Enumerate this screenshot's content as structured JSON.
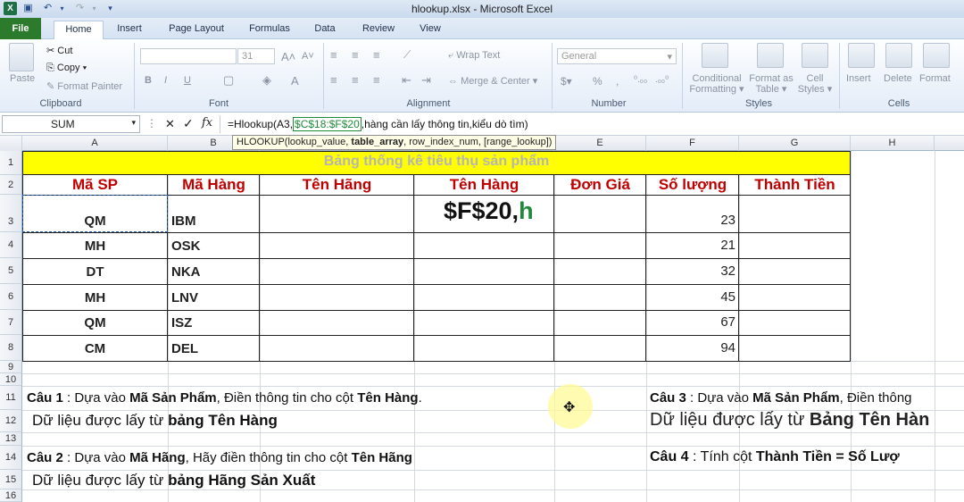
{
  "window": {
    "title": "hlookup.xlsx  -  Microsoft Excel"
  },
  "tabs": [
    "File",
    "Home",
    "Insert",
    "Page Layout",
    "Formulas",
    "Data",
    "Review",
    "View"
  ],
  "ribbon": {
    "clipboard": {
      "paste": "Paste",
      "cut": "Cut",
      "copy": "Copy ▾",
      "format_painter": "Format Painter",
      "label": "Clipboard"
    },
    "font": {
      "size": "31",
      "label": "Font"
    },
    "alignment": {
      "wrap": "Wrap Text",
      "merge": "Merge & Center ▾",
      "label": "Alignment"
    },
    "number": {
      "format": "General",
      "label": "Number"
    },
    "styles": {
      "conditional": "Conditional Formatting ▾",
      "format_table": "Format as Table ▾",
      "cell_styles": "Cell Styles ▾",
      "label": "Styles"
    },
    "cells": {
      "insert": "Insert",
      "delete": "Delete",
      "format": "Format",
      "label": "Cells"
    }
  },
  "formula_bar": {
    "name_box": "SUM",
    "formula_prefix": "=Hlookup(A3,",
    "formula_ref": "$C$18:$F$20",
    "formula_suffix": ",hàng cần lấy thông tin,kiểu dò tìm)",
    "tooltip_a": "HLOOKUP(lookup_value, ",
    "tooltip_b": "table_array",
    "tooltip_c": ", row_index_num, [range_lookup])"
  },
  "columns": [
    "A",
    "B",
    "C",
    "D",
    "E",
    "F",
    "G",
    "H"
  ],
  "rows": [
    "1",
    "2",
    "3",
    "4",
    "5",
    "6",
    "7",
    "8",
    "9",
    "10",
    "11",
    "12",
    "13",
    "14",
    "15",
    "16"
  ],
  "table": {
    "title": "Bảng thống kê tiêu thụ sản phẩm",
    "headers": [
      "Mã SP",
      "Mã Hàng",
      "Tên Hãng",
      "Tên Hàng",
      "Đơn Giá",
      "Số lượng",
      "Thành Tiền"
    ],
    "rows": [
      {
        "ma_sp": "QM",
        "ma_hang": "IBM",
        "so_luong": "23"
      },
      {
        "ma_sp": "MH",
        "ma_hang": "OSK",
        "so_luong": "21"
      },
      {
        "ma_sp": "DT",
        "ma_hang": "NKA",
        "so_luong": "32"
      },
      {
        "ma_sp": "MH",
        "ma_hang": "LNV",
        "so_luong": "45"
      },
      {
        "ma_sp": "QM",
        "ma_hang": "ISZ",
        "so_luong": "67"
      },
      {
        "ma_sp": "CM",
        "ma_hang": "DEL",
        "so_luong": "94"
      }
    ],
    "editing_a": "$F$20,",
    "editing_b": "h"
  },
  "questions": {
    "c1_a": "Câu 1",
    "c1_b": " : Dựa vào ",
    "c1_c": "Mã Sản Phẩm",
    "c1_d": ", Điền thông tin cho cột ",
    "c1_e": "Tên Hàng",
    "c1_f": ".",
    "r12_a": "Dữ liệu được lấy từ ",
    "r12_b": "bảng Tên Hàng",
    "c2_a": "Câu 2",
    "c2_b": " : Dựa vào ",
    "c2_c": "Mã Hãng",
    "c2_d": ", Hãy điền thông tin cho cột ",
    "c2_e": "Tên Hãng",
    "r15_a": "Dữ liệu được lấy từ ",
    "r15_b": "bảng Hãng Sản Xuất",
    "c3_a": "Câu 3",
    "c3_b": " : Dựa vào ",
    "c3_c": "Mã Sản Phẩm",
    "c3_d": ", Điền thông",
    "r12r_a": "Dữ liệu được lấy từ ",
    "r12r_b": "Bảng Tên Hàn",
    "c4_a": "Câu 4",
    "c4_b": " : Tính cột ",
    "c4_c": "Thành Tiền = Số Lượ"
  },
  "colors": {
    "title_fill": "#ffff00",
    "header_text": "#c00000",
    "file_tab": "#2c7a2c",
    "ref_green": "#1f8a3a"
  }
}
